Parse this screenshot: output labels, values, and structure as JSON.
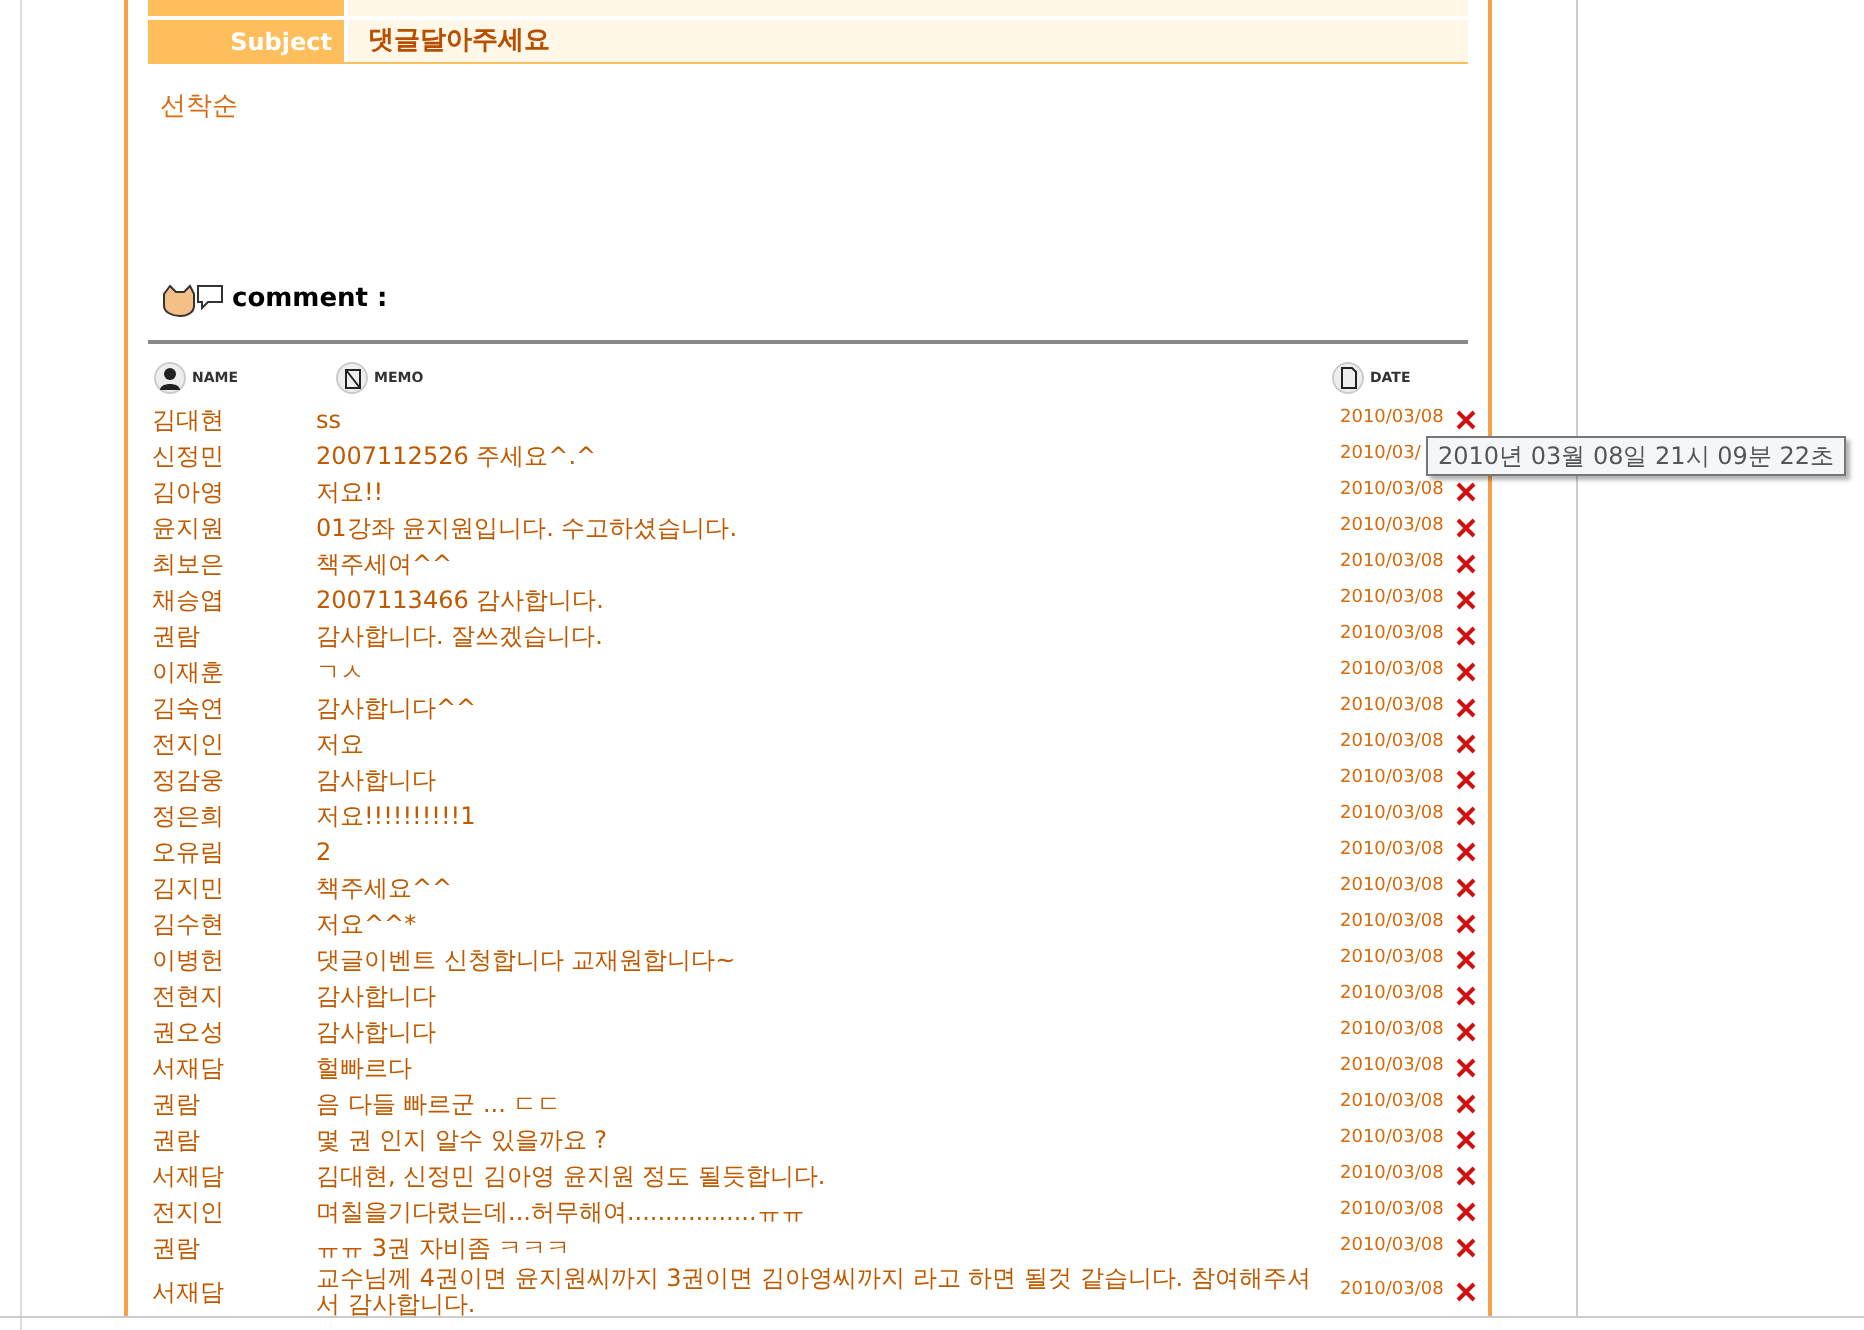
{
  "post": {
    "subject_label": "Subject",
    "subject": "댓글달아주세요",
    "body": "선착순"
  },
  "comments": {
    "title": "comment :",
    "columns": {
      "name": "NAME",
      "memo": "MEMO",
      "date": "DATE"
    },
    "rows": [
      {
        "name": "김대현",
        "memo": "ss",
        "date": "2010/03/08",
        "delete": true
      },
      {
        "name": "신정민",
        "memo": "2007112526 주세요^.^",
        "date": "2010/03/",
        "delete": false
      },
      {
        "name": "김아영",
        "memo": "저요!!",
        "date": "2010/03/08",
        "delete": true
      },
      {
        "name": "윤지원",
        "memo": "01강좌 윤지원입니다. 수고하셨습니다.",
        "date": "2010/03/08",
        "delete": true
      },
      {
        "name": "최보은",
        "memo": "책주세여^^",
        "date": "2010/03/08",
        "delete": true
      },
      {
        "name": "채승엽",
        "memo": "2007113466 감사합니다.",
        "date": "2010/03/08",
        "delete": true
      },
      {
        "name": "권람",
        "memo": "감사합니다. 잘쓰겠습니다.",
        "date": "2010/03/08",
        "delete": true
      },
      {
        "name": "이재훈",
        "memo": "ㄱㅅ",
        "date": "2010/03/08",
        "delete": true
      },
      {
        "name": "김숙연",
        "memo": "감사합니다^^",
        "date": "2010/03/08",
        "delete": true
      },
      {
        "name": "전지인",
        "memo": "저요",
        "date": "2010/03/08",
        "delete": true
      },
      {
        "name": "정감웅",
        "memo": "감사합니다",
        "date": "2010/03/08",
        "delete": true
      },
      {
        "name": "정은희",
        "memo": "저요!!!!!!!!!!1",
        "date": "2010/03/08",
        "delete": true
      },
      {
        "name": "오유림",
        "memo": "2",
        "date": "2010/03/08",
        "delete": true
      },
      {
        "name": "김지민",
        "memo": "책주세요^^",
        "date": "2010/03/08",
        "delete": true
      },
      {
        "name": "김수현",
        "memo": "저요^^*",
        "date": "2010/03/08",
        "delete": true
      },
      {
        "name": "이병헌",
        "memo": "댓글이벤트 신청합니다 교재원합니다~",
        "date": "2010/03/08",
        "delete": true
      },
      {
        "name": "전현지",
        "memo": "감사합니다",
        "date": "2010/03/08",
        "delete": true
      },
      {
        "name": "권오성",
        "memo": "감사합니다",
        "date": "2010/03/08",
        "delete": true
      },
      {
        "name": "서재담",
        "memo": "헐빠르다",
        "date": "2010/03/08",
        "delete": true
      },
      {
        "name": "권람",
        "memo": "음 다들 빠르군 ... ㄷㄷ",
        "date": "2010/03/08",
        "delete": true
      },
      {
        "name": "권람",
        "memo": "몇 권 인지 알수 있을까요 ?",
        "date": "2010/03/08",
        "delete": true
      },
      {
        "name": "서재담",
        "memo": "김대현, 신정민 김아영 윤지원 정도 될듯합니다.",
        "date": "2010/03/08",
        "delete": true
      },
      {
        "name": "전지인",
        "memo": "며칠을기다렸는데...허무해여.................ㅠㅠ",
        "date": "2010/03/08",
        "delete": true
      },
      {
        "name": "권람",
        "memo": "ㅠㅠ 3권 자비좀 ㅋㅋㅋ",
        "date": "2010/03/08",
        "delete": true
      },
      {
        "name": "서재담",
        "memo": "교수님께 4권이면 윤지원씨까지 3권이면 김아영씨까지 라고 하면 될것 같습니다. 참여해주셔서 감사합니다.",
        "date": "2010/03/08",
        "delete": true
      }
    ]
  },
  "tooltip": "2010년 03월 08일 21시 09분 22초"
}
